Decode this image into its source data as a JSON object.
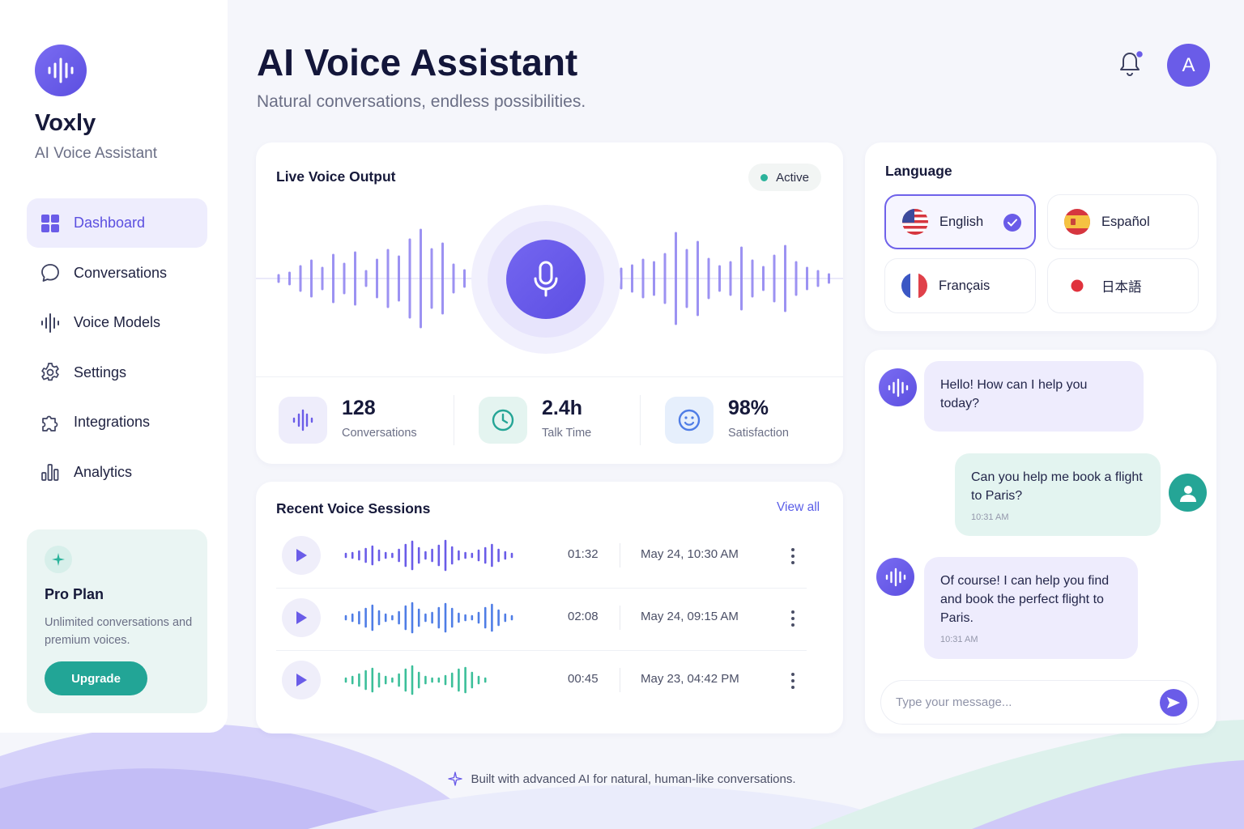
{
  "sidebar": {
    "brand_name": "Voxly",
    "brand_subtitle": "AI Voice Assistant",
    "items": [
      {
        "label": "Dashboard",
        "icon": "grid-icon",
        "active": true
      },
      {
        "label": "Conversations",
        "icon": "chat-bubble-icon",
        "active": false
      },
      {
        "label": "Voice Models",
        "icon": "waveform-icon",
        "active": false
      },
      {
        "label": "Settings",
        "icon": "gear-icon",
        "active": false
      },
      {
        "label": "Integrations",
        "icon": "puzzle-icon",
        "active": false
      },
      {
        "label": "Analytics",
        "icon": "bar-chart-icon",
        "active": false
      }
    ],
    "pro_plan": {
      "title": "Pro Plan",
      "description": "Unlimited conversations and premium voices.",
      "button_label": "Upgrade"
    }
  },
  "header": {
    "title": "AI Voice Assistant",
    "subtitle": "Natural conversations, endless possibilities.",
    "avatar_initial": "A"
  },
  "live_output": {
    "title": "Live Voice Output",
    "status": "Active",
    "stats": [
      {
        "value": "128",
        "label": "Conversations",
        "icon": "waveform-icon"
      },
      {
        "value": "2.4h",
        "label": "Talk Time",
        "icon": "clock-icon"
      },
      {
        "value": "98%",
        "label": "Satisfaction",
        "icon": "smile-icon"
      }
    ]
  },
  "sessions": {
    "title": "Recent Voice Sessions",
    "view_all": "View all",
    "rows": [
      {
        "duration": "01:32",
        "date": "May 24, 10:30 AM",
        "color": "#6a5ce8"
      },
      {
        "duration": "02:08",
        "date": "May 24, 09:15 AM",
        "color": "#4f7de6"
      },
      {
        "duration": "00:45",
        "date": "May 23, 04:42 PM",
        "color": "#3cbf9a"
      }
    ]
  },
  "language": {
    "title": "Language",
    "options": [
      {
        "label": "English",
        "flag": "us-flag-icon",
        "selected": true
      },
      {
        "label": "Español",
        "flag": "spain-flag-icon",
        "selected": false
      },
      {
        "label": "Français",
        "flag": "france-flag-icon",
        "selected": false
      },
      {
        "label": "日本語",
        "flag": "japan-flag-icon",
        "selected": false
      }
    ]
  },
  "chat": {
    "messages": [
      {
        "from": "bot",
        "text": "Hello! How can I help you today?",
        "time": ""
      },
      {
        "from": "user",
        "text": "Can you help me book a flight to Paris?",
        "time": "10:31 AM"
      },
      {
        "from": "bot",
        "text": "Of course! I can help you find and book the perfect flight to Paris.",
        "time": "10:31 AM"
      }
    ],
    "input_placeholder": "Type your message..."
  },
  "footer": {
    "note": "Built with advanced AI for natural, human-like conversations."
  },
  "colors": {
    "accent": "#6a5ce8",
    "teal": "#22a596",
    "active_status": "#2bb39b"
  }
}
